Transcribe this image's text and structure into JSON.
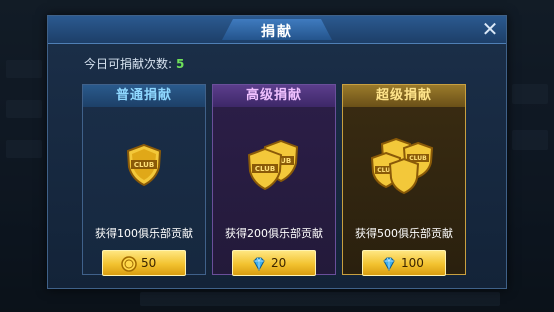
{
  "dialog": {
    "title": "捐献",
    "close_label": "✕",
    "count_label": "今日可捐献次数:",
    "count_value": "5"
  },
  "cards": [
    {
      "title": "普通捐献",
      "reward": "获得100俱乐部贡献",
      "cost": "50",
      "cost_icon": "coin-icon"
    },
    {
      "title": "高级捐献",
      "reward": "获得200俱乐部贡献",
      "cost": "20",
      "cost_icon": "diamond-icon"
    },
    {
      "title": "超级捐献",
      "reward": "获得500俱乐部贡献",
      "cost": "100",
      "cost_icon": "diamond-icon"
    }
  ],
  "badge_text": "CLUB",
  "colors": {
    "count_value": "#6ee05a",
    "gold_button": "#f2c230",
    "diamond": "#3fb0f0"
  }
}
